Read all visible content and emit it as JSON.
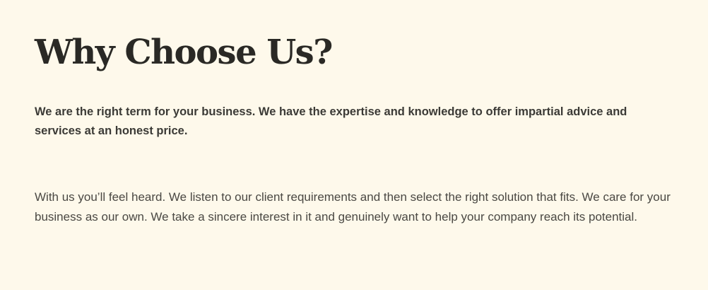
{
  "section": {
    "heading": "Why Choose Us?",
    "lead": "We are the right term for your business. We have the expertise and knowledge to offer impartial advice and services at an honest price.",
    "body": "With us you’ll feel heard. We listen to our client requirements and then select the right solution that fits. We care for your business as our own. We take a sincere interest in it and genuinely want to help your company reach its potential."
  },
  "colors": {
    "background": "#fef9eb",
    "heading": "#2a2925",
    "lead": "#3b3a36",
    "body": "#4a4843"
  }
}
